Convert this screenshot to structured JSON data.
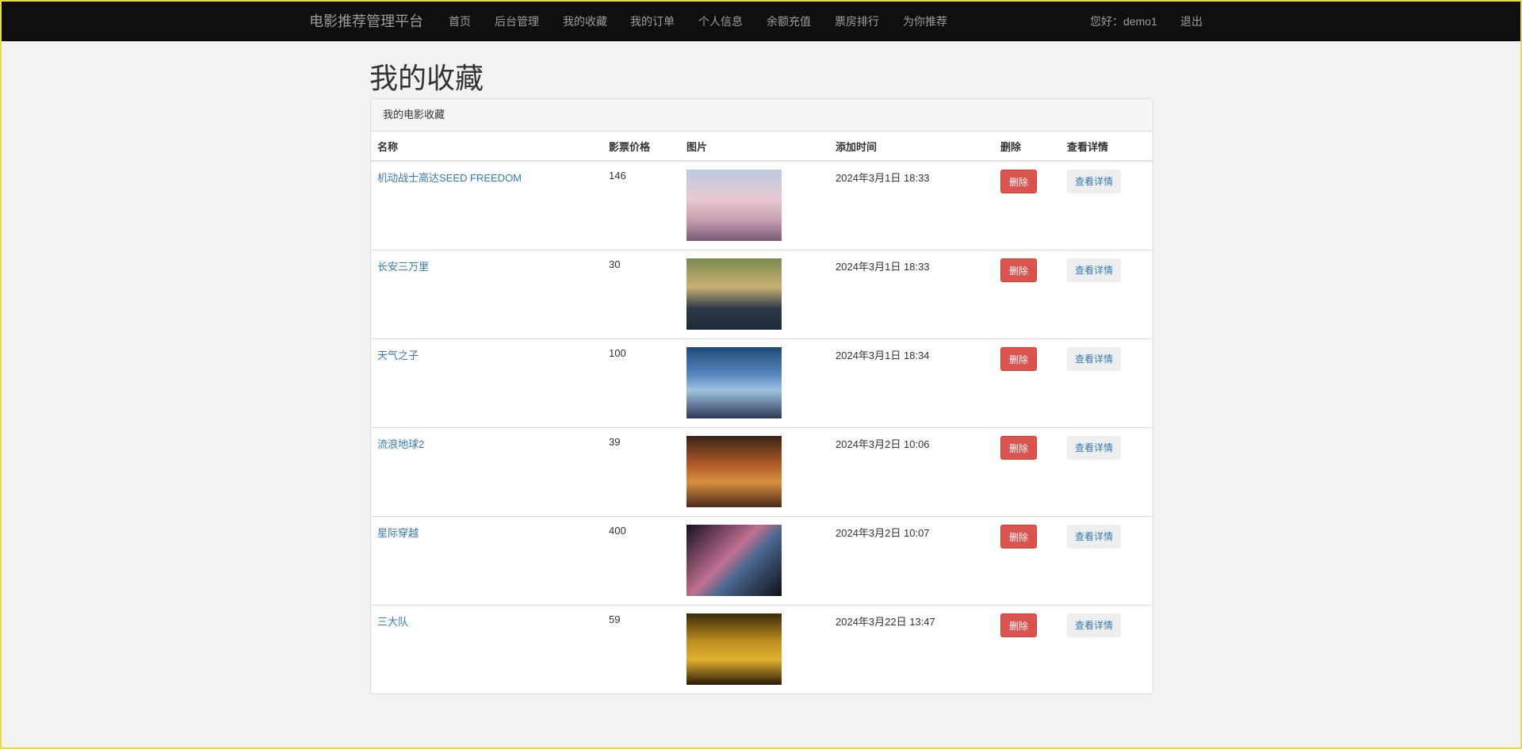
{
  "nav": {
    "brand": "电影推荐管理平台",
    "items": [
      "首页",
      "后台管理",
      "我的收藏",
      "我的订单",
      "个人信息",
      "余额充值",
      "票房排行",
      "为你推荐"
    ],
    "greeting": "您好：demo1",
    "logout": "退出"
  },
  "page_title": "我的收藏",
  "panel_title": "我的电影收藏",
  "columns": [
    "名称",
    "影票价格",
    "图片",
    "添加时间",
    "删除",
    "查看详情"
  ],
  "rows": [
    {
      "name": "机动战士高达SEED FREEDOM",
      "price": "146",
      "time": "2024年3月1日 18:33",
      "delete": "删除",
      "detail": "查看详情"
    },
    {
      "name": "长安三万里",
      "price": "30",
      "time": "2024年3月1日 18:33",
      "delete": "删除",
      "detail": "查看详情"
    },
    {
      "name": "天气之子",
      "price": "100",
      "time": "2024年3月1日 18:34",
      "delete": "删除",
      "detail": "查看详情"
    },
    {
      "name": "流浪地球2",
      "price": "39",
      "time": "2024年3月2日 10:06",
      "delete": "删除",
      "detail": "查看详情"
    },
    {
      "name": "星际穿越",
      "price": "400",
      "time": "2024年3月2日 10:07",
      "delete": "删除",
      "detail": "查看详情"
    },
    {
      "name": "三大队",
      "price": "59",
      "time": "2024年3月22日 13:47",
      "delete": "删除",
      "detail": "查看详情"
    }
  ]
}
